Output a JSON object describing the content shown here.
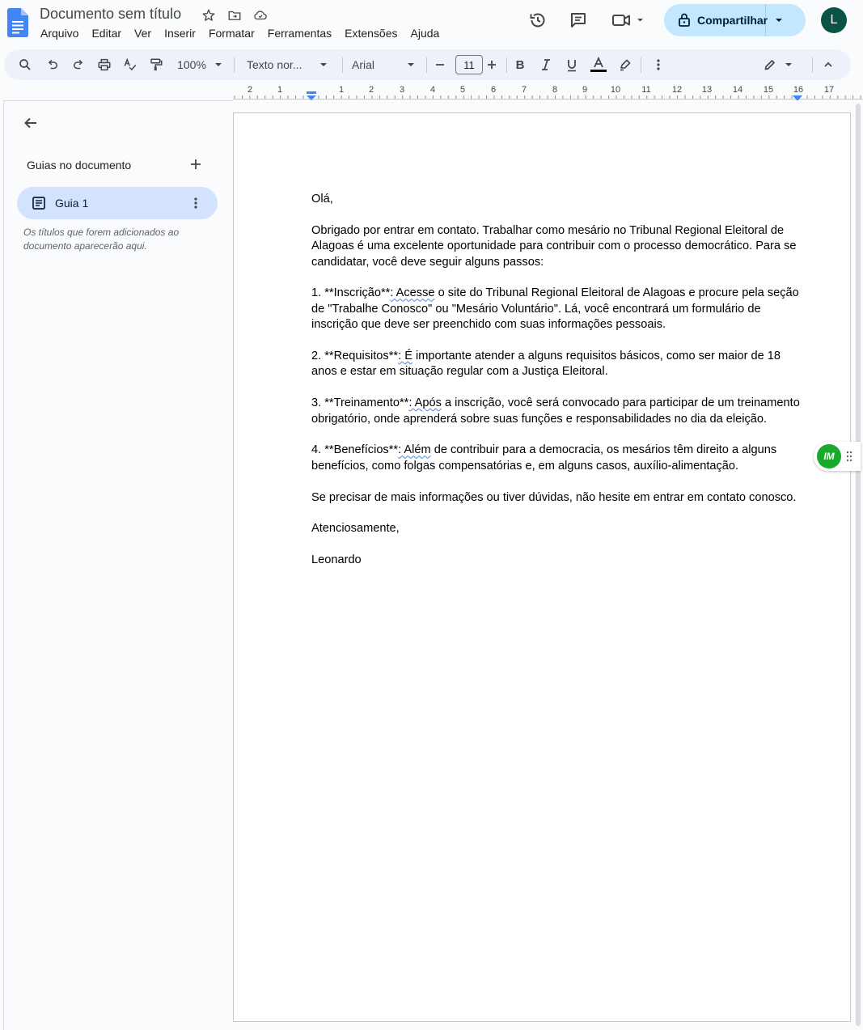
{
  "app": {
    "document_title": "Documento sem título",
    "menu": [
      "Arquivo",
      "Editar",
      "Ver",
      "Inserir",
      "Formatar",
      "Ferramentas",
      "Extensões",
      "Ajuda"
    ],
    "share_label": "Compartilhar",
    "avatar_initial": "L"
  },
  "toolbar": {
    "zoom": "100%",
    "style": "Texto nor...",
    "font": "Arial",
    "font_size": "11"
  },
  "ruler": {
    "labels": [
      "2",
      "1",
      "1",
      "2",
      "3",
      "4",
      "5",
      "6",
      "7",
      "8",
      "9",
      "10",
      "11",
      "12",
      "13",
      "14",
      "15",
      "16",
      "17"
    ]
  },
  "sidebar": {
    "heading": "Guias no documento",
    "tab_label": "Guia 1",
    "hint": "Os títulos que forem adicionados ao documento aparecerão aqui."
  },
  "document": {
    "greeting": "Olá,",
    "intro": "Obrigado por entrar em contato. Trabalhar como mesário no Tribunal Regional Eleitoral de Alagoas é uma excelente oportunidade para contribuir com o processo democrático. Para se candidatar, você deve seguir alguns passos:",
    "items": [
      {
        "lead": "1. **Inscrição**",
        "mark": ": Acesse",
        "rest": " o site do Tribunal Regional Eleitoral de Alagoas e procure pela seção de \"Trabalhe Conosco\" ou \"Mesário Voluntário\". Lá, você encontrará um formulário de inscrição que deve ser preenchido com suas informações pessoais."
      },
      {
        "lead": "2. **Requisitos**",
        "mark": ": É",
        "rest": " importante atender a alguns requisitos básicos, como ser maior de 18 anos e estar em situação regular com a Justiça Eleitoral."
      },
      {
        "lead": "3. **Treinamento**",
        "mark": ": Após",
        "rest": " a inscrição, você será convocado para participar de um treinamento obrigatório, onde aprenderá sobre suas funções e responsabilidades no dia da eleição."
      },
      {
        "lead": "4. **Benefícios**",
        "mark": ": Além",
        "rest": " de contribuir para a democracia, os mesários têm direito a alguns benefícios, como folgas compensatórias e, em alguns casos, auxílio-alimentação."
      }
    ],
    "closing": "Se precisar de mais informações ou tiver dúvidas, não hesite em entrar em contato conosco.",
    "signoff": "Atenciosamente,",
    "signature": "Leonardo"
  },
  "addon": {
    "label": "IM"
  }
}
